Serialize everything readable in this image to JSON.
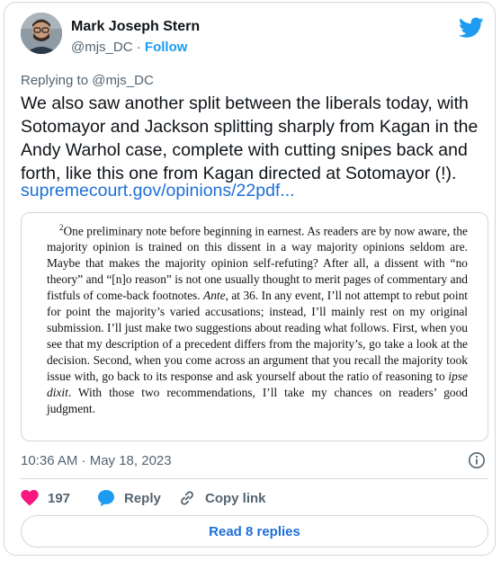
{
  "author": {
    "name": "Mark Joseph Stern",
    "handle": "@mjs_DC",
    "separator": "·",
    "follow_label": "Follow"
  },
  "reply_to": "Replying to @mjs_DC",
  "tweet": {
    "text": "We also saw another split between the liberals today, with Sotomayor and Jackson splitting sharply from Kagan in the Andy Warhol case, complete with cutting snipes back and forth, like this one from Kagan directed at Sotomayor (!).",
    "link": "supremecourt.gov/opinions/22pdf..."
  },
  "quote_image": {
    "footnote_number": "2",
    "seg1": "One preliminary note before beginning in earnest. As readers are by now aware, the majority opinion is trained on this dissent in a way majority opinions seldom are. Maybe that makes the majority opinion self-refuting? After all, a dissent with “no theory” and “[n]o reason” is not one usually thought to merit pages of commentary and fistfuls of come-back footnotes.",
    "ante": "Ante",
    "seg2": ", at 36. In any event, I’ll not attempt to rebut point for point the majority’s varied accusations; instead, I’ll mainly rest on my original submission. I’ll just make two suggestions about reading what follows. First, when you see that my description of a precedent differs from the majority’s, go take a look at the decision. Second, when you come across an argument that you recall the majority took issue with, go back to its response and ask yourself about the ratio of reasoning to",
    "ipse_dixit": "ipse dixit",
    "seg3": ". With those two recommendations, I’ll take my chances on readers’ good judgment."
  },
  "timestamp": "10:36 AM · May 18, 2023",
  "actions": {
    "like_count": "197",
    "reply_label": "Reply",
    "copy_link_label": "Copy link"
  },
  "read_replies_label": "Read 8 replies",
  "colors": {
    "accent": "#1d9bf0",
    "link": "#1d6fd6",
    "like": "#f91880",
    "muted": "#536471",
    "border": "#cfd9de"
  },
  "icons": [
    "twitter-bird-icon",
    "info-icon",
    "heart-icon",
    "reply-bubble-icon",
    "link-icon"
  ]
}
